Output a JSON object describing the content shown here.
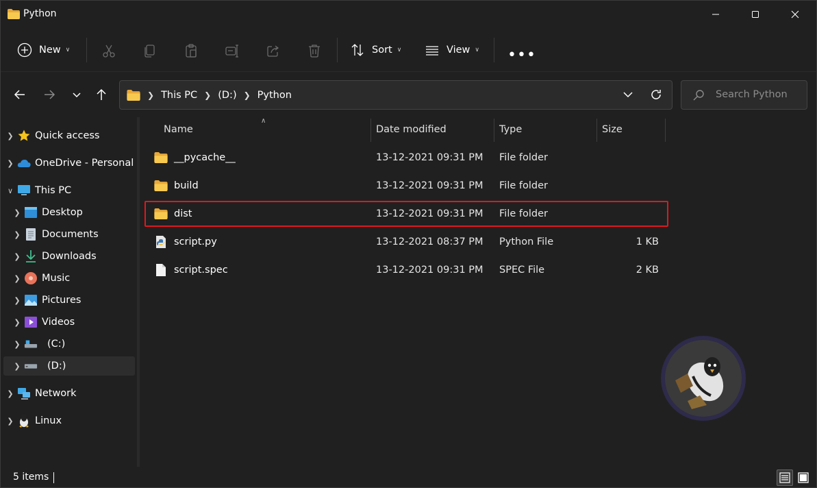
{
  "window": {
    "title": "Python",
    "controls": [
      "minimize",
      "maximize",
      "close"
    ]
  },
  "toolbar": {
    "new_label": "New",
    "sort_label": "Sort",
    "view_label": "View",
    "more_label": "•••",
    "icons": [
      "cut-icon",
      "copy-icon",
      "paste-icon",
      "rename-icon",
      "share-icon",
      "delete-icon"
    ]
  },
  "address": {
    "crumbs": [
      "This PC",
      "(D:)",
      "Python"
    ]
  },
  "search": {
    "placeholder": "Search Python"
  },
  "sidebar": {
    "items": [
      {
        "label": "Quick access",
        "icon": "star-icon"
      },
      {
        "label": "OneDrive - Personal",
        "icon": "cloud-icon"
      },
      {
        "label": "This PC",
        "icon": "monitor-icon"
      },
      {
        "label": "Desktop",
        "icon": "desktop-icon"
      },
      {
        "label": "Documents",
        "icon": "document-icon"
      },
      {
        "label": "Downloads",
        "icon": "download-icon"
      },
      {
        "label": "Music",
        "icon": "music-icon"
      },
      {
        "label": "Pictures",
        "icon": "pictures-icon"
      },
      {
        "label": "Videos",
        "icon": "videos-icon"
      },
      {
        "label": "(C:)",
        "icon": "drive-icon"
      },
      {
        "label": "(D:)",
        "icon": "drive-icon",
        "selected": true
      },
      {
        "label": "Network",
        "icon": "network-icon"
      },
      {
        "label": "Linux",
        "icon": "linux-icon"
      }
    ]
  },
  "columns": {
    "name": "Name",
    "date": "Date modified",
    "type": "Type",
    "size": "Size"
  },
  "files": [
    {
      "name": "__pycache__",
      "date": "13-12-2021 09:31 PM",
      "type": "File folder",
      "size": "",
      "icon": "folder-icon"
    },
    {
      "name": "build",
      "date": "13-12-2021 09:31 PM",
      "type": "File folder",
      "size": "",
      "icon": "folder-icon"
    },
    {
      "name": "dist",
      "date": "13-12-2021 09:31 PM",
      "type": "File folder",
      "size": "",
      "icon": "folder-icon",
      "highlighted": true
    },
    {
      "name": "script.py",
      "date": "13-12-2021 08:37 PM",
      "type": "Python File",
      "size": "1 KB",
      "icon": "python-file-icon"
    },
    {
      "name": "script.spec",
      "date": "13-12-2021 09:31 PM",
      "type": "SPEC File",
      "size": "2 KB",
      "icon": "file-icon"
    }
  ],
  "status": {
    "count_text": "5 items"
  },
  "colors": {
    "background": "#202020",
    "highlight_border": "#e0181f",
    "folder": "#f5c04a"
  }
}
